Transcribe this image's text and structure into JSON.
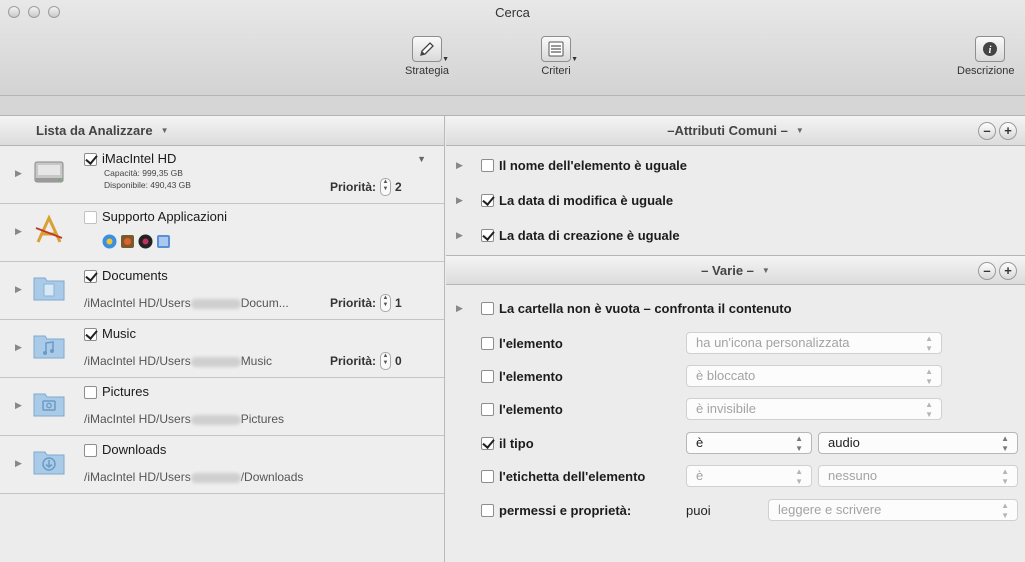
{
  "window": {
    "title": "Cerca"
  },
  "toolbar": {
    "strategy_label": "Strategia",
    "criteria_label": "Criteri",
    "description_label": "Descrizione"
  },
  "left_pane": {
    "header": "Lista da Analizzare",
    "items": [
      {
        "name": "iMacIntel HD",
        "checked": true,
        "capacity": "Capacità: 999,35 GB",
        "available": "Disponibile: 490,43 GB",
        "priority_label": "Priorità:",
        "priority": "2",
        "icon": "hard-drive-icon"
      },
      {
        "name": "Supporto Applicazioni",
        "checked": false,
        "icon": "applications-icon"
      },
      {
        "name": "Documents",
        "checked": true,
        "path_start": "/iMacIntel HD/Users",
        "path_end": "Docum...",
        "priority_label": "Priorità:",
        "priority": "1",
        "icon": "folder-documents-icon"
      },
      {
        "name": "Music",
        "checked": true,
        "path_start": "/iMacIntel HD/Users",
        "path_end": "Music",
        "priority_label": "Priorità:",
        "priority": "0",
        "icon": "folder-music-icon"
      },
      {
        "name": "Pictures",
        "checked": false,
        "path_start": "/iMacIntel HD/Users",
        "path_end": "Pictures",
        "icon": "folder-pictures-icon"
      },
      {
        "name": "Downloads",
        "checked": false,
        "path_start": "/iMacIntel HD/Users",
        "path_end": "/Downloads",
        "icon": "folder-downloads-icon"
      }
    ]
  },
  "right_pane": {
    "common_header": "–Attributi Comuni –",
    "common_rows": [
      {
        "label": "Il nome dell'elemento è uguale",
        "checked": false
      },
      {
        "label": "La data di modifica è uguale",
        "checked": true
      },
      {
        "label": "La data di creazione è uguale",
        "checked": true
      }
    ],
    "misc_header": "– Varie –",
    "misc_rows": [
      {
        "label": "La cartella non è vuota – confronta il contenuto",
        "checked": false
      },
      {
        "label": "l'elemento",
        "checked": false,
        "select": "ha un'icona personalizzata"
      },
      {
        "label": "l'elemento",
        "checked": false,
        "select": "è bloccato"
      },
      {
        "label": "l'elemento",
        "checked": false,
        "select": "è invisibile"
      },
      {
        "label": "il tipo",
        "checked": true,
        "select1": "è",
        "select2": "audio"
      },
      {
        "label": "l'etichetta dell'elemento",
        "checked": false,
        "select1": "è",
        "select2": "nessuno"
      },
      {
        "label": "permessi e proprietà:",
        "checked": false,
        "plain": "puoi",
        "select": "leggere e scrivere"
      }
    ],
    "minus": "–",
    "plus": "+"
  },
  "colors": {
    "chrome": "#d3d3d3",
    "pane": "#ececec",
    "select_dim": "#a3a3a3"
  }
}
